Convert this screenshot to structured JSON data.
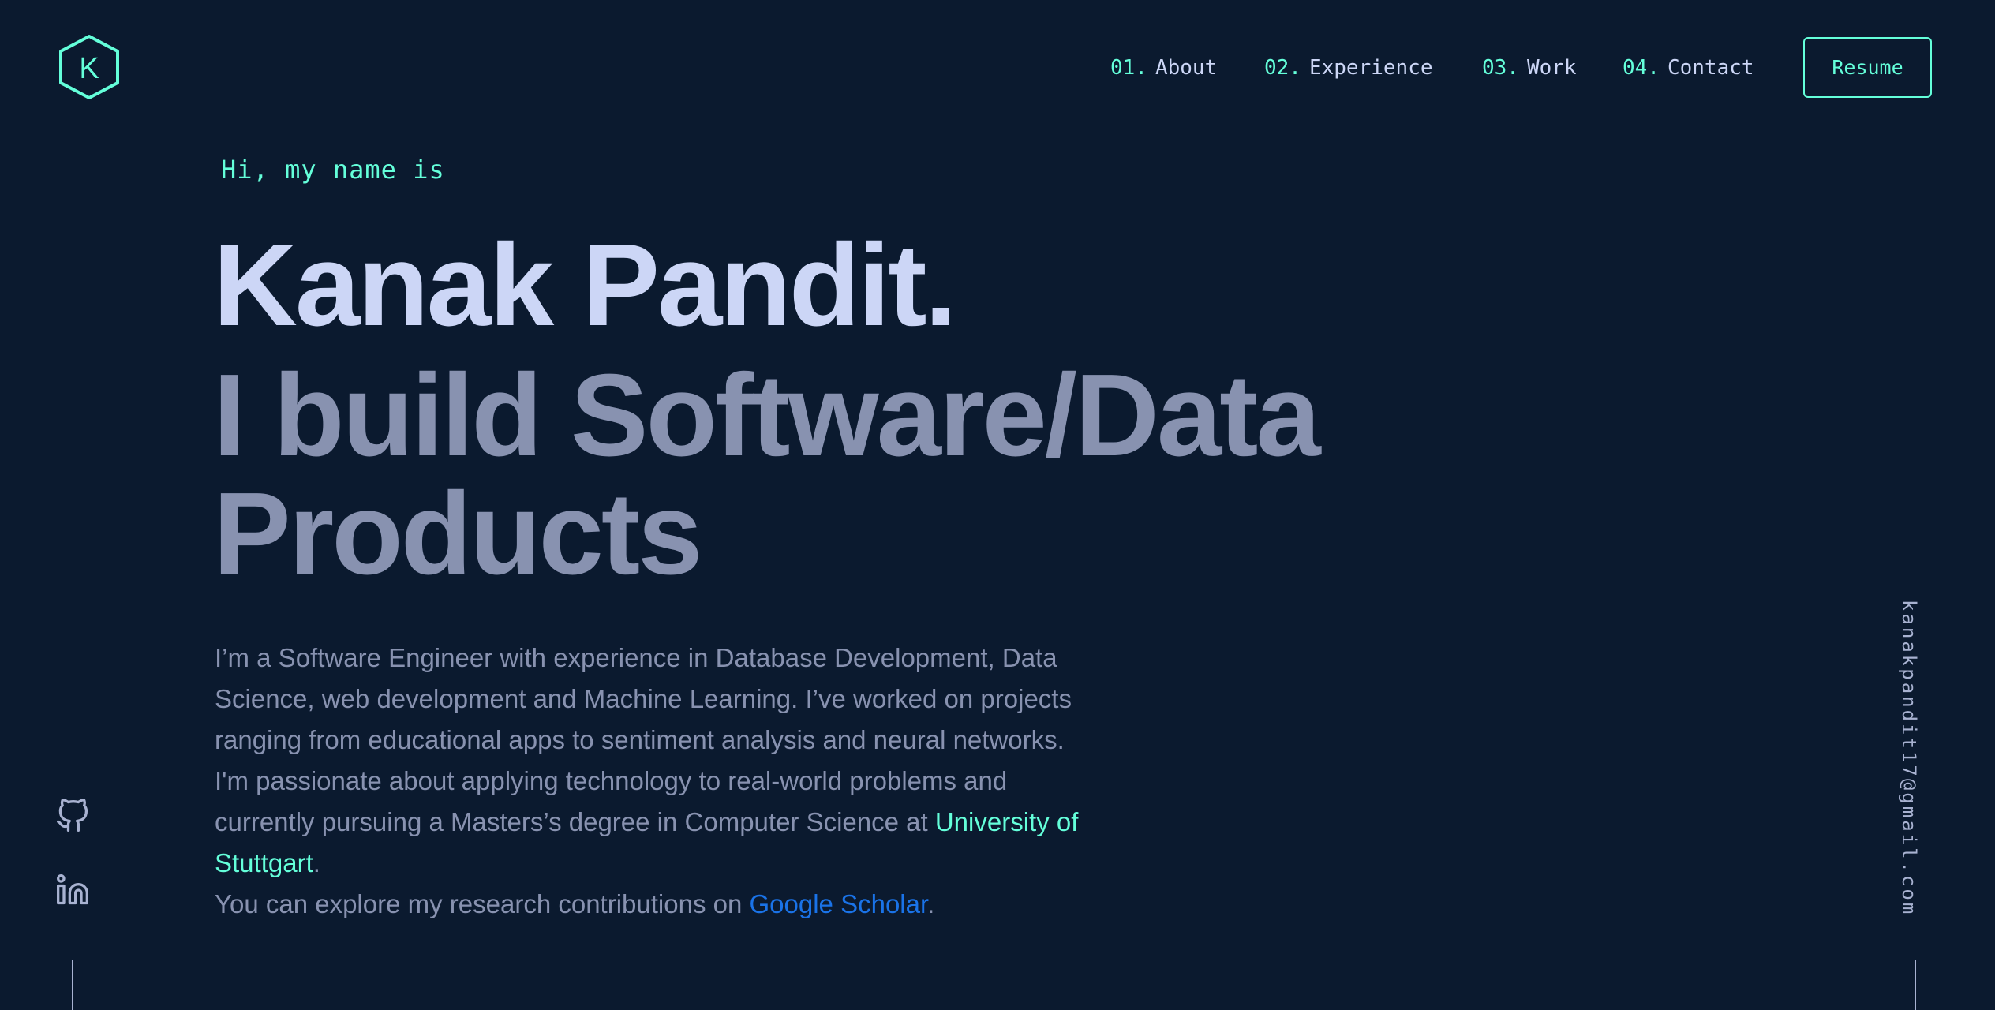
{
  "header": {
    "logo_letter": "K",
    "nav": [
      {
        "num": "01.",
        "label": "About"
      },
      {
        "num": "02.",
        "label": "Experience"
      },
      {
        "num": "03.",
        "label": "Work"
      },
      {
        "num": "04.",
        "label": "Contact"
      }
    ],
    "resume_label": "Resume"
  },
  "hero": {
    "greeting": "Hi, my name is",
    "name": "Kanak Pandit.",
    "tagline": "I build Software/Data Products",
    "bio_text": "I’m a Software Engineer with experience in Database Development, Data Science, web development and Machine Learning. I’ve worked on projects ranging from educational apps to sentiment analysis and neural networks. I'm passionate about applying technology to real-world problems and currently pursuing a Masters’s degree in Computer Science at ",
    "university_link": "University of Stuttgart",
    "bio_after_uni": ".",
    "research_text": "You can explore my research contributions on ",
    "scholar_link": "Google Scholar",
    "research_after": "."
  },
  "social": {
    "icons": [
      "github-icon",
      "linkedin-icon"
    ]
  },
  "email": "kanakpandit17@gmail.com",
  "colors": {
    "background": "#0b1a2f",
    "accent": "#64ffda",
    "heading": "#ccd6f6",
    "muted": "#8892b0",
    "scholar_link": "#1a73e8"
  }
}
